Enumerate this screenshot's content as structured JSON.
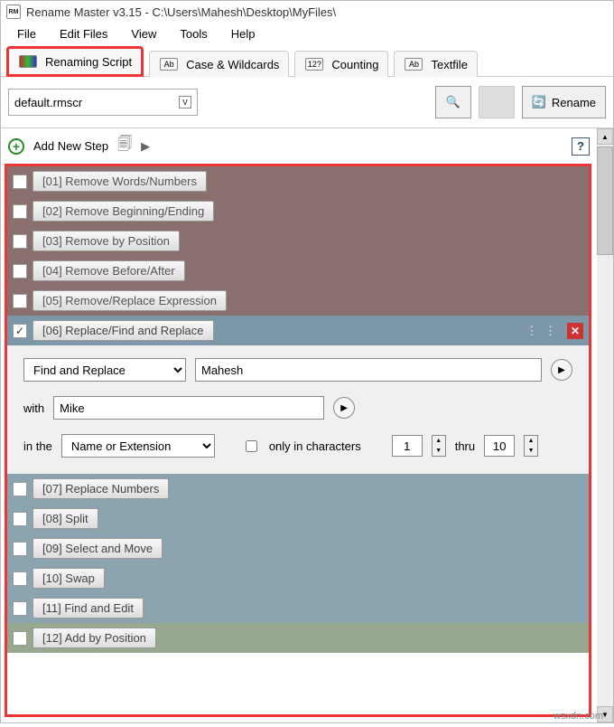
{
  "title": "Rename Master v3.15 - C:\\Users\\Mahesh\\Desktop\\MyFiles\\",
  "app_icon_text": "RM",
  "menus": {
    "file": "File",
    "edit": "Edit Files",
    "view": "View",
    "tools": "Tools",
    "help": "Help"
  },
  "tabs": {
    "script": "Renaming Script",
    "case": "Case & Wildcards",
    "counting": "Counting",
    "textfile": "Textfile"
  },
  "toolbar": {
    "script_name": "default.rmscr",
    "rename_label": "Rename"
  },
  "addstep": {
    "label": "Add New Step"
  },
  "steps": {
    "s1": "[01]  Remove Words/Numbers",
    "s2": "[02]  Remove Beginning/Ending",
    "s3": "[03]  Remove by Position",
    "s4": "[04]  Remove Before/After",
    "s5": "[05]  Remove/Replace Expression",
    "s6": "[06]  Replace/Find and Replace",
    "s7": "[07]  Replace Numbers",
    "s8": "[08]  Split",
    "s9": "[09]  Select and Move",
    "s10": "[10]  Swap",
    "s11": "[11]  Find and Edit",
    "s12": "[12]  Add by Position"
  },
  "active": {
    "mode": "Find and Replace",
    "find_value": "Mahesh",
    "with_label": "with",
    "with_value": "Mike",
    "in_the_label": "in the",
    "scope": "Name or Extension",
    "only_label": "only in characters",
    "from": "1",
    "thru_label": "thru",
    "to": "10"
  },
  "watermark": "wsxdn.com"
}
